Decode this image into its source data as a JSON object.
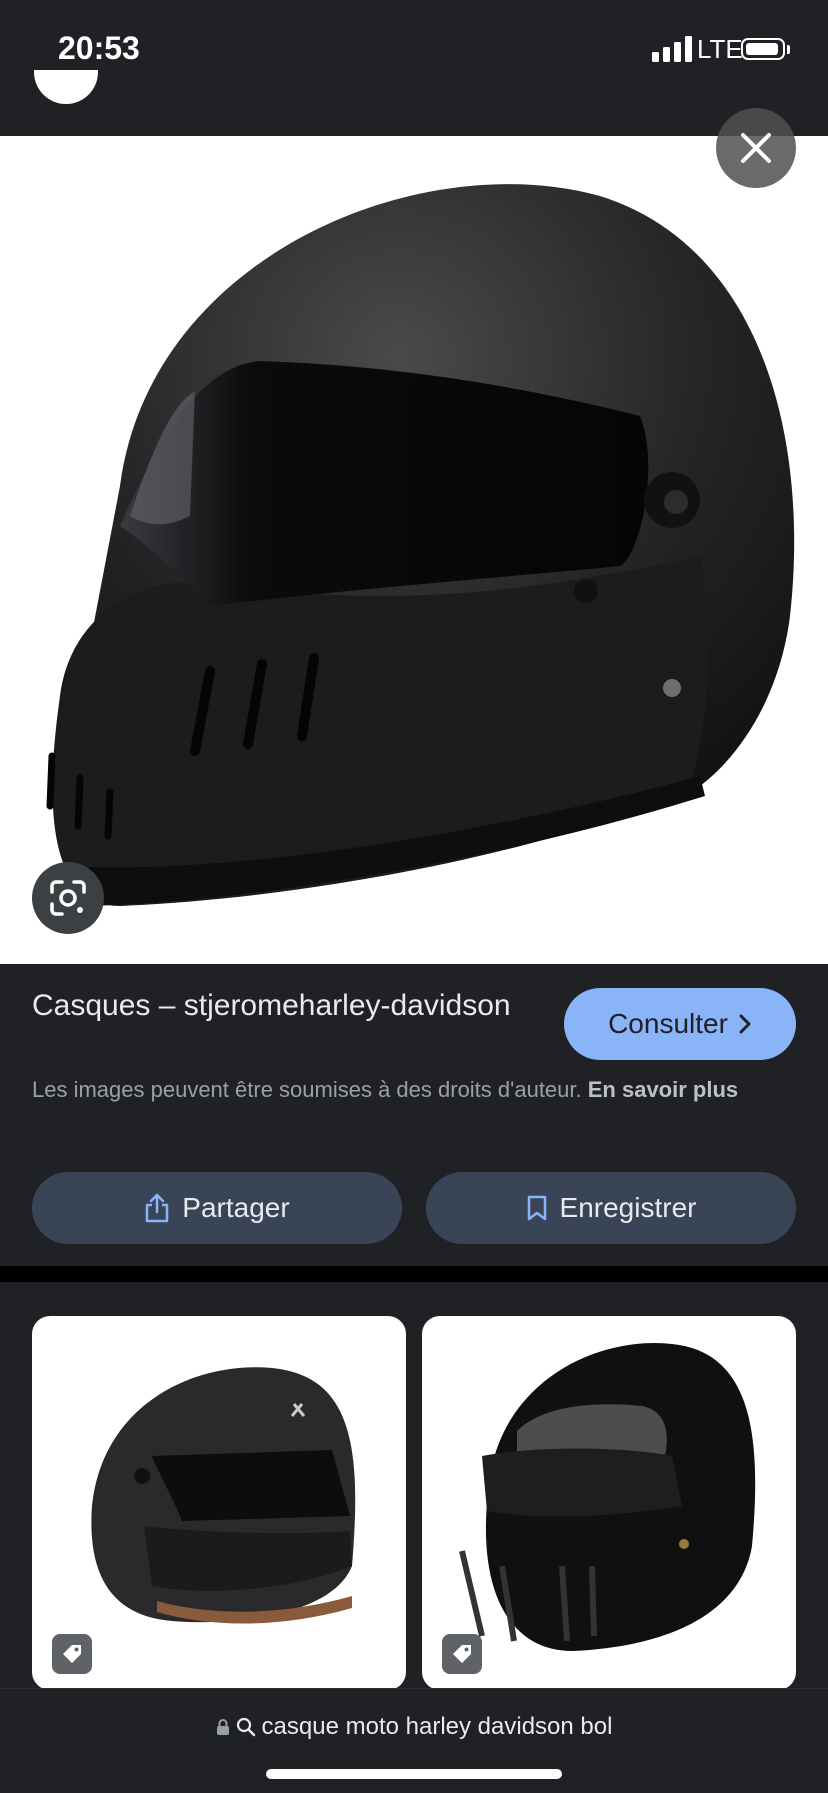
{
  "status_bar": {
    "time": "20:53",
    "network": "LTE"
  },
  "result": {
    "title": "Casques – stjeromeharley-davidson",
    "visit_label": "Consulter",
    "copyright_text": "Les images peuvent être soumises à des droits d'auteur.",
    "learn_more": "En savoir plus",
    "share_label": "Partager",
    "save_label": "Enregistrer"
  },
  "address_bar": {
    "query": "casque moto harley davidson bol"
  },
  "icons": {
    "close": "close-icon",
    "lens": "google-lens-icon",
    "share": "share-icon",
    "save": "bookmark-icon",
    "tag": "tag-icon",
    "lock": "lock-icon",
    "search": "search-icon"
  },
  "colors": {
    "background": "#202124",
    "accent_button": "#8ab4f8",
    "secondary_button": "#394457"
  }
}
